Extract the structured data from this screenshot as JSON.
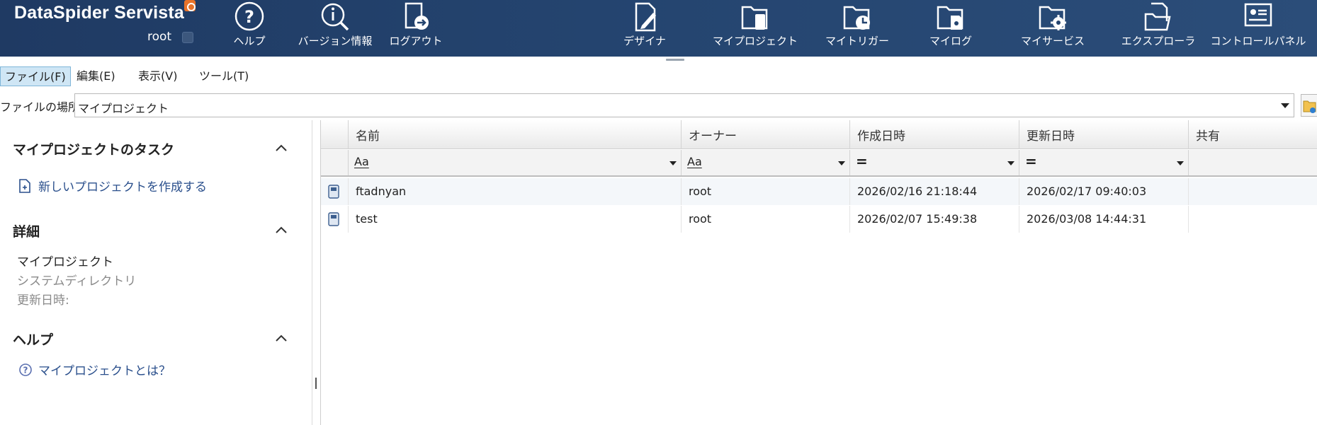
{
  "app": {
    "brand": "DataSpider Servista",
    "user": "root"
  },
  "header_left_buttons": [
    {
      "label": "ヘルプ",
      "icon": "help-icon"
    },
    {
      "label": "バージョン情報",
      "icon": "version-info-icon"
    },
    {
      "label": "ログアウト",
      "icon": "logout-icon"
    }
  ],
  "header_right_buttons": [
    {
      "label": "デザイナ",
      "icon": "designer-icon"
    },
    {
      "label": "マイプロジェクト",
      "icon": "my-project-icon"
    },
    {
      "label": "マイトリガー",
      "icon": "my-trigger-icon"
    },
    {
      "label": "マイログ",
      "icon": "my-log-icon"
    },
    {
      "label": "マイサービス",
      "icon": "my-service-icon"
    },
    {
      "label": "エクスプローラ",
      "icon": "explorer-icon"
    },
    {
      "label": "コントロールパネル",
      "icon": "control-panel-icon"
    }
  ],
  "menu": {
    "items": [
      "ファイル(F)",
      "編集(E)",
      "表示(V)",
      "ツール(T)"
    ],
    "active": "ファイル(F)"
  },
  "location": {
    "label": "ファイルの場所",
    "value": "マイプロジェクト"
  },
  "left_pane": {
    "tasks": {
      "title": "マイプロジェクトのタスク",
      "link": "新しいプロジェクトを作成する"
    },
    "details": {
      "title": "詳細",
      "name": "マイプロジェクト",
      "type": "システムディレクトリ",
      "updated_label": "更新日時:"
    },
    "help": {
      "title": "ヘルプ",
      "link": "マイプロジェクトとは？"
    }
  },
  "table": {
    "columns": [
      "名前",
      "オーナー",
      "作成日時",
      "更新日時",
      "共有"
    ],
    "filters": [
      "Aa",
      "Aa",
      "=",
      "=",
      ""
    ],
    "rows": [
      {
        "name": "ftadnyan",
        "owner": "root",
        "created": "2026/02/16 21:18:44",
        "updated": "2026/02/17 09:40:03",
        "shared": ""
      },
      {
        "name": "test",
        "owner": "root",
        "created": "2026/02/07 15:49:38",
        "updated": "2026/03/08 14:44:31",
        "shared": ""
      }
    ]
  },
  "colors": {
    "header_bg": "#24446f",
    "link": "#2a4f8c",
    "menu_active_bg": "#cfe6f5",
    "brand_badge": "#e8732a"
  }
}
